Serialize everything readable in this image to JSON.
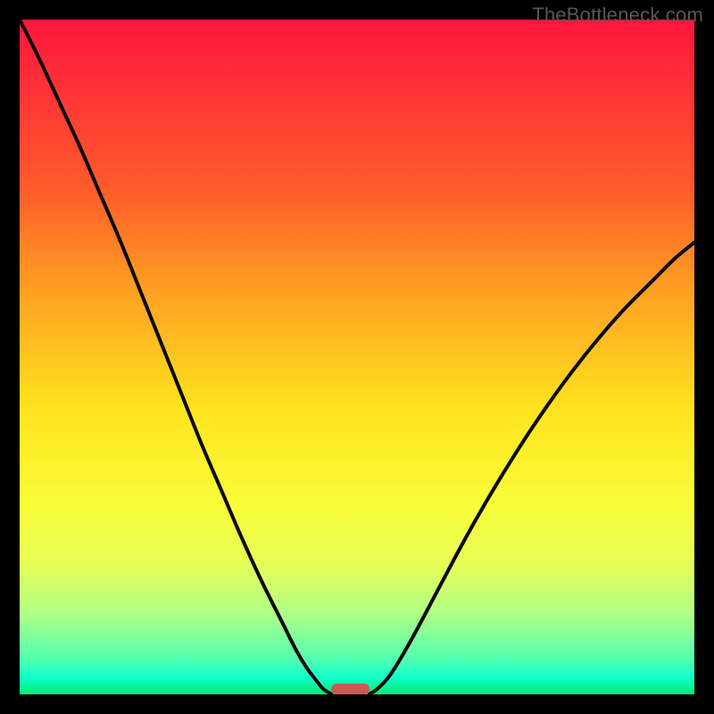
{
  "watermark": "TheBottleneck.com",
  "colors": {
    "frame": "#000000",
    "curve": "#080808",
    "marker": "#c65a57",
    "gradient_top": "#ff153e",
    "gradient_bottom": "#00ee72"
  },
  "chart_data": {
    "type": "line",
    "title": "",
    "xlabel": "",
    "ylabel": "",
    "xlim": [
      0,
      100
    ],
    "ylim": [
      0,
      100
    ],
    "grid": false,
    "series": [
      {
        "name": "left-curve",
        "x": [
          0,
          3,
          6,
          9,
          12,
          15,
          18,
          21,
          24,
          27,
          30,
          33,
          36,
          39,
          41,
          42.5,
          44,
          45,
          46,
          46.2
        ],
        "y": [
          100,
          94,
          87.5,
          81,
          74,
          67,
          59.5,
          52,
          44.5,
          37,
          30,
          23,
          16.5,
          10.5,
          6.5,
          4,
          2,
          0.8,
          0.15,
          0
        ]
      },
      {
        "name": "right-curve",
        "x": [
          51.8,
          52,
          53,
          55,
          58,
          62,
          66,
          70,
          74,
          78,
          82,
          86,
          90,
          94,
          97,
          100
        ],
        "y": [
          0,
          0.15,
          0.8,
          3,
          8,
          15.5,
          23,
          30,
          36.5,
          42.5,
          48,
          53,
          57.5,
          61.5,
          64.5,
          67
        ]
      }
    ],
    "marker": {
      "x_start": 46.2,
      "x_end": 51.8,
      "y": 0,
      "height_pct": 1.6
    }
  }
}
